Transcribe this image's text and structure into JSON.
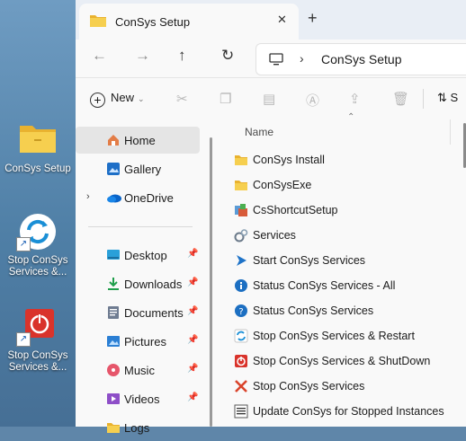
{
  "desktop": {
    "icons": [
      {
        "label": "ConSys Setup",
        "icon": "folder-icon"
      },
      {
        "label": "Stop ConSys Services &...",
        "icon": "restart-icon"
      },
      {
        "label": "Stop ConSys Services &...",
        "icon": "power-icon"
      }
    ]
  },
  "tab": {
    "title": "ConSys Setup",
    "close": "✕",
    "new": "+"
  },
  "nav": {
    "back": "←",
    "forward": "→",
    "up": "↑",
    "refresh": "↻",
    "path_sep": "›",
    "path": "ConSys Setup"
  },
  "commandbar": {
    "new_label": "New",
    "sort_label": "S"
  },
  "sidebar": {
    "items": [
      {
        "label": "Home",
        "icon": "home-icon"
      },
      {
        "label": "Gallery",
        "icon": "gallery-icon"
      },
      {
        "label": "OneDrive",
        "icon": "cloud-icon",
        "expander": "›"
      },
      {
        "label": "Desktop",
        "icon": "desktop-icon",
        "pinned": true
      },
      {
        "label": "Downloads",
        "icon": "download-icon",
        "pinned": true
      },
      {
        "label": "Documents",
        "icon": "documents-icon",
        "pinned": true
      },
      {
        "label": "Pictures",
        "icon": "pictures-icon",
        "pinned": true
      },
      {
        "label": "Music",
        "icon": "music-icon",
        "pinned": true
      },
      {
        "label": "Videos",
        "icon": "videos-icon",
        "pinned": true
      },
      {
        "label": "Logs",
        "icon": "folder-icon"
      }
    ]
  },
  "filelist": {
    "column_name": "Name",
    "files": [
      {
        "name": "ConSys Install",
        "icon": "folder-icon"
      },
      {
        "name": "ConSysExe",
        "icon": "folder-icon"
      },
      {
        "name": "CsShortcutSetup",
        "icon": "installer-icon"
      },
      {
        "name": "Services",
        "icon": "services-icon"
      },
      {
        "name": "Start ConSys Services",
        "icon": "start-icon"
      },
      {
        "name": "Status ConSys Services - All",
        "icon": "info-icon"
      },
      {
        "name": "Status ConSys Services",
        "icon": "help-icon"
      },
      {
        "name": "Stop ConSys Services & Restart",
        "icon": "restart-icon"
      },
      {
        "name": "Stop ConSys Services & ShutDown",
        "icon": "power-icon"
      },
      {
        "name": "Stop ConSys Services",
        "icon": "stop-icon"
      },
      {
        "name": "Update ConSys for Stopped Instances",
        "icon": "update-icon"
      }
    ]
  },
  "colors": {
    "accent": "#0067c0",
    "folder": "#f3c53a",
    "selected": "#e5e5e5"
  }
}
